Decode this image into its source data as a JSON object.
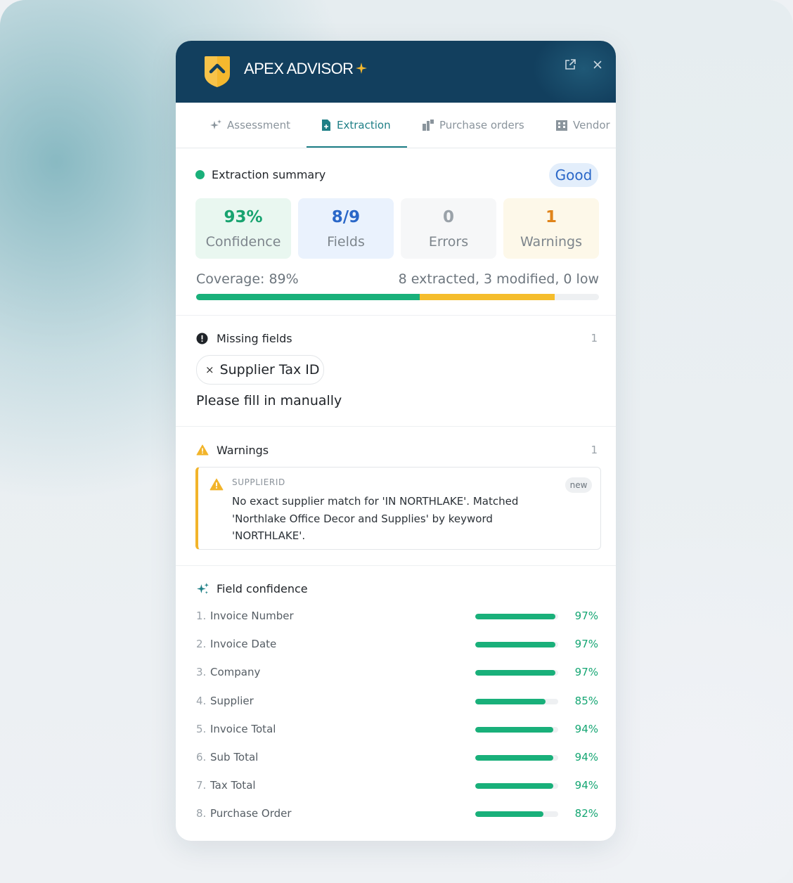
{
  "header": {
    "title": "APEX ADVISOR"
  },
  "tabs": [
    {
      "label": "Assessment",
      "icon": "sparkle-icon",
      "active": false
    },
    {
      "label": "Extraction",
      "icon": "document-icon",
      "active": true
    },
    {
      "label": "Purchase orders",
      "icon": "boxes-icon",
      "active": false
    },
    {
      "label": "Vendor",
      "icon": "building-icon",
      "active": false
    }
  ],
  "summary": {
    "title": "Extraction summary",
    "status": "Good",
    "stats": [
      {
        "value": "93%",
        "label": "Confidence",
        "color": "#17a36f",
        "bg": "#e9f7f0"
      },
      {
        "value": "8/9",
        "label": "Fields",
        "color": "#2a67c8",
        "bg": "#eaf2fd"
      },
      {
        "value": "0",
        "label": "Errors",
        "color": "#9aa2a9",
        "bg": "#f6f7f8"
      },
      {
        "value": "1",
        "label": "Warnings",
        "color": "#e0841a",
        "bg": "#fdf8e9"
      }
    ],
    "coverage_label": "Coverage: 89%",
    "coverage_detail": "8 extracted, 3 modified, 0 low",
    "coverage_bar": {
      "green": 0.555,
      "yellow": 0.335
    }
  },
  "missing": {
    "title": "Missing fields",
    "count": "1",
    "chip_remove": "×",
    "chip": "Supplier Tax ID",
    "hint": "Please fill in manually"
  },
  "warnings": {
    "title": "Warnings",
    "count": "1",
    "items": [
      {
        "code": "SUPPLIERID",
        "message": "No exact supplier match for 'IN NORTHLAKE'. Matched 'Northlake Office Decor and Supplies' by keyword 'NORTHLAKE'.",
        "badge": "new"
      }
    ]
  },
  "field_confidence": {
    "title": "Field confidence",
    "rows": [
      {
        "index": "1.",
        "name": "Invoice Number",
        "pct": "97%",
        "value": 0.97
      },
      {
        "index": "2.",
        "name": "Invoice Date",
        "pct": "97%",
        "value": 0.97
      },
      {
        "index": "3.",
        "name": "Company",
        "pct": "97%",
        "value": 0.97
      },
      {
        "index": "4.",
        "name": "Supplier",
        "pct": "85%",
        "value": 0.85
      },
      {
        "index": "5.",
        "name": "Invoice Total",
        "pct": "94%",
        "value": 0.94
      },
      {
        "index": "6.",
        "name": "Sub Total",
        "pct": "94%",
        "value": 0.94
      },
      {
        "index": "7.",
        "name": "Tax Total",
        "pct": "94%",
        "value": 0.94
      },
      {
        "index": "8.",
        "name": "Purchase Order",
        "pct": "82%",
        "value": 0.82
      }
    ]
  }
}
